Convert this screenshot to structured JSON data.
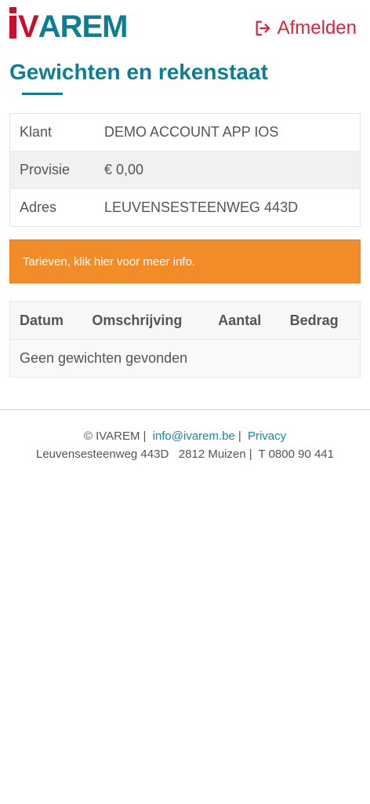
{
  "header": {
    "logo_first": "V",
    "logo_rest": "AREM",
    "logout_label": "Afmelden"
  },
  "page": {
    "title": "Gewichten en rekenstaat"
  },
  "info": {
    "rows": [
      {
        "label": "Klant",
        "value": "DEMO ACCOUNT APP IOS"
      },
      {
        "label": "Provisie",
        "value": "€ 0,00"
      },
      {
        "label": "Adres",
        "value": "LEUVENSESTEENWEG 443D"
      }
    ]
  },
  "alert": {
    "text": "Tarieven, klik hier voor meer info."
  },
  "weights": {
    "columns": [
      "Datum",
      "Omschrijving",
      "Aantal",
      "Bedrag"
    ],
    "empty_text": "Geen gewichten gevonden"
  },
  "footer": {
    "copyright": "© IVAREM",
    "email": "info@ivarem.be",
    "privacy": "Privacy",
    "street": "Leuvensesteenweg 443D",
    "city": "2812 Muizen",
    "phone": "T 0800 90 441"
  },
  "colors": {
    "brand_teal": "#0e7f93",
    "brand_red": "#c8102e",
    "alert_orange": "#f28c28",
    "link_blue": "#1b86a6"
  },
  "icons": {
    "logout": "sign-out-icon"
  }
}
